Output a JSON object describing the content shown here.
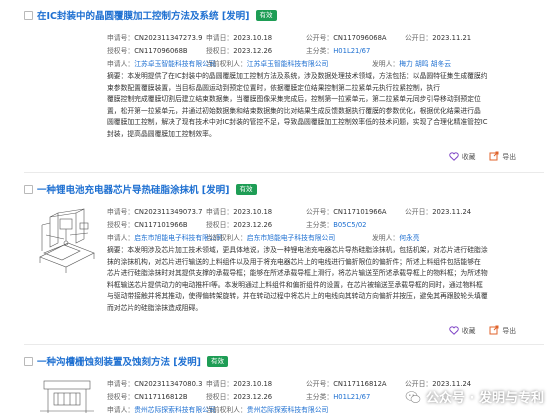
{
  "results": [
    {
      "title": "在IC封装中的晶圆覆膜加工控制方法及系统 [发明]",
      "status": "有效",
      "rows": [
        [
          {
            "k": "申请号：",
            "v": "CN2023113472​73.9"
          },
          {
            "k": "申请日：",
            "v": "2023.10.18"
          },
          {
            "k": "公开号：",
            "v": "CN117096068A"
          },
          {
            "k": "公开日：",
            "v": "2023.11.21"
          }
        ],
        [
          {
            "k": "授权号：",
            "v": "CN117096068B"
          },
          {
            "k": "授权日：",
            "v": "2023.12.26"
          },
          {
            "k": "主分类：",
            "v": "H01L21/67",
            "link": true
          }
        ],
        [
          {
            "k": "申请人：",
            "v": "江苏卓玉智能科技有限公司",
            "link": true
          },
          {
            "k": "当前权利人：",
            "v": "江苏卓玉智能科技有限公司",
            "link": true
          },
          {
            "k": "发明人：",
            "v": "梅力  胡鸣  胡冬云",
            "link": true
          }
        ]
      ],
      "abstract": [
        "摘要：本发明提供了在IC封装中的晶圆覆膜加工控制方法及系统，涉及数据处理技术领域，方法包括：以晶圆特征集生成覆膜约",
        "束参数配置覆膜装置，当目标晶圆运动到预定位置时，依据覆膜定位结果控制第二拉紧单元执行拉紧控制，执行",
        "覆膜控制完成覆膜切割后建立结束数据集，当覆膜图像采集完成后，控制第一拉紧单元，第二拉紧单元同步引导移动到预定位",
        "置，松开第一拉紧单元，并通过初始数据集和结束数据集的比对结果生成反馈数据执行覆膜的参数优化，根据优化结果进行晶",
        "圆覆膜加工控制，解决了现有技术中对IC封装的管控不足，导致晶圆覆膜加工控制效率低的技术问题，实现了合理化精准管控IC",
        "封装，提高晶圆覆膜加工控制效率。"
      ],
      "actions": {
        "collect": "收藏",
        "export": "导出"
      }
    },
    {
      "title": "一种锂电池充电器芯片导热硅脂涂抹机 [发明]",
      "status": "有效",
      "rows": [
        [
          {
            "k": "申请号：",
            "v": "CN2023113490​73.7"
          },
          {
            "k": "申请日：",
            "v": "2023.10.18"
          },
          {
            "k": "公开号：",
            "v": "CN117101966A"
          },
          {
            "k": "公开日：",
            "v": "2023.11.24"
          }
        ],
        [
          {
            "k": "授权号：",
            "v": "CN117101966B"
          },
          {
            "k": "授权日：",
            "v": "2023.12.26"
          },
          {
            "k": "主分类：",
            "v": "B05C5/02",
            "link": true
          }
        ],
        [
          {
            "k": "申请人：",
            "v": "启东市旭能电子科技有限公司",
            "link": true
          },
          {
            "k": "当前权利人：",
            "v": "启东市旭能电子科技有限公司",
            "link": true
          },
          {
            "k": "发明人：",
            "v": "何永亮",
            "link": true
          }
        ]
      ],
      "abstract": [
        "摘要：本发明涉及芯片加工技术领域，更具体地说，涉及一种锂电池充电器芯片导热硅脂涂抹机，包括机架，对芯片进行硅脂涂",
        "抹的涂抹机构，对芯片进行输送的上料组件以及用于将充电器芯片上的电线进行偏折限位的偏折件；所述上料组件包括能够在",
        "芯片进行硅脂涂抹时对其提供支撑的承载导框；能够在所述承载导框上滑行，将芯片输送至所述承载导框上的物料框；为所述物",
        "料框输送芯片提供动力的电动推杆Ⅰ等。本发明通过上料组件和偏折组件的设置，在芯片被输送至承载导框的同时，通过物料框",
        "与驱动带接触并将其推动，使得偏转架旋转，并在转动过程中将芯片上的电线向其转动方向偏折并按压，避免其再跟胶轮头填覆",
        "而对芯片的硅脂涂抹造成阻碍。"
      ],
      "actions": {
        "collect": "收藏",
        "export": "导出"
      }
    },
    {
      "title": "一种沟槽栅蚀刻装置及蚀刻方法 [发明]",
      "status": "有效",
      "rows": [
        [
          {
            "k": "申请号：",
            "v": "CN2023113470​80.3"
          },
          {
            "k": "申请日：",
            "v": "2023.10.18"
          },
          {
            "k": "公开号：",
            "v": "CN117116812A"
          },
          {
            "k": "公开日：",
            "v": "2023.11.24"
          }
        ],
        [
          {
            "k": "授权号：",
            "v": "CN117116812B"
          },
          {
            "k": "授权日：",
            "v": "2023.12.26"
          },
          {
            "k": "主分类：",
            "v": "H01L21/67",
            "link": true
          }
        ],
        [
          {
            "k": "申请人：",
            "v": "贵州芯际探索科技有限公司",
            "link": true
          },
          {
            "k": "当前权利人：",
            "v": "贵州芯际探索科技有限公司",
            "link": true
          }
        ]
      ],
      "abstract": [],
      "actions": {
        "collect": "收藏",
        "export": "导出"
      }
    }
  ],
  "watermark": {
    "text": "公众号 · 发明与专利"
  },
  "colors": {
    "link": "#1d6fd1",
    "badge": "#1e9d55",
    "collect_icon": "#7b3fc4",
    "export_icon": "#e0632b"
  }
}
